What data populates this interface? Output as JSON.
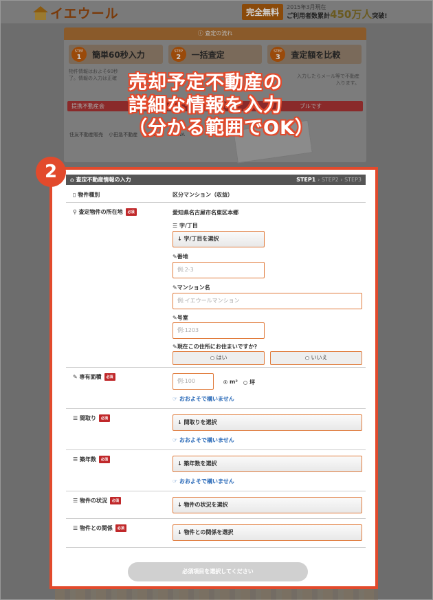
{
  "header": {
    "logo_text": "イエウール",
    "promo_free": "完全無料",
    "promo_date": "2015年3月現在",
    "promo_users_prefix": "ご利用者数累計",
    "promo_users_count": "450万人",
    "promo_users_suffix": "突破!"
  },
  "flow": {
    "title": "査定の流れ",
    "steps": [
      {
        "step": "STEP",
        "num": "1",
        "label": "簡単60秒入力"
      },
      {
        "step": "STEP",
        "num": "2",
        "label": "一括査定"
      },
      {
        "step": "STEP",
        "num": "3",
        "label": "査定額を比較"
      }
    ],
    "desc_left": "物件情報はおよそ60秒\n了。情報の入力は正確",
    "desc_right": "入力したらメール等で不動産\n入ります。",
    "bar_text": "提携不動産会",
    "bar_tail": "ブルです",
    "partners": [
      "住友不動産販売",
      "小田急不動産",
      "MIZUHO",
      "DAIWA"
    ]
  },
  "caption": {
    "line1": "売却予定不動産の",
    "line2": "詳細な情報を入力",
    "line3": "（分かる範囲でOK）"
  },
  "badge": "2",
  "form": {
    "title": "査定不動産情報の入力",
    "step_current": "STEP1",
    "step2": "STEP2",
    "step3": "STEP3",
    "required_label": "必須",
    "property_type": {
      "label": "物件種別",
      "value": "区分マンション（収益）"
    },
    "location": {
      "label": "査定物件の所在地",
      "address": "愛知県名古屋市名東区本郷",
      "aza_label": "字/丁目",
      "aza_button": "字/丁目を選択",
      "banchi_label": "番地",
      "banchi_placeholder": "例:2-3",
      "mansion_label": "マンション名",
      "mansion_placeholder": "例:イエウールマンション",
      "room_label": "号室",
      "room_placeholder": "例:1203",
      "living_label": "現在この住所にお住まいですか?",
      "living_yes": "はい",
      "living_no": "いいえ"
    },
    "area": {
      "label": "専有面積",
      "placeholder": "例:100",
      "unit_m2": "m²",
      "unit_tsubo": "坪",
      "hint": "おおよそで構いません"
    },
    "layout": {
      "label": "間取り",
      "button": "間取りを選択",
      "hint": "おおよそで構いません"
    },
    "age": {
      "label": "築年数",
      "button": "築年数を選択",
      "hint": "おおよそで構いません"
    },
    "status": {
      "label": "物件の状況",
      "button": "物件の状況を選択"
    },
    "relation": {
      "label": "物件との関係",
      "button": "物件との関係を選択"
    },
    "submit": "必須項目を選択してください"
  }
}
